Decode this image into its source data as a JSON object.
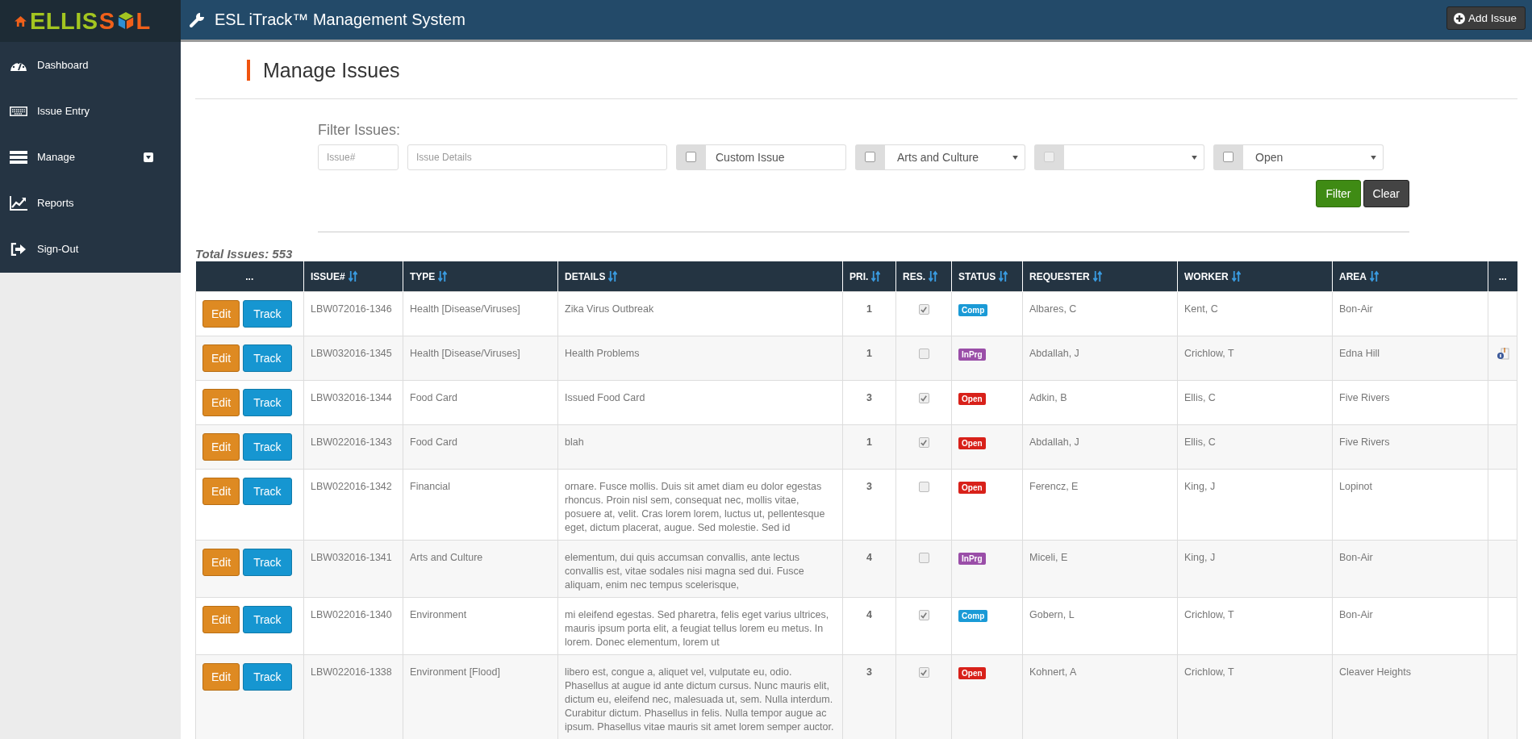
{
  "logo": {
    "parts": [
      {
        "kind": "text",
        "text": "ELLIS",
        "color": "#a3c520"
      },
      {
        "kind": "text",
        "text": "S",
        "color": "#f0601a"
      },
      {
        "kind": "cube"
      },
      {
        "kind": "text",
        "text": "L",
        "color": "#f0601a"
      }
    ]
  },
  "header": {
    "title": "ESL iTrack™ Management System",
    "add_button": "Add Issue"
  },
  "sidebar": {
    "items": [
      {
        "label": "Dashboard",
        "dropdown": false
      },
      {
        "label": "Issue Entry",
        "dropdown": false
      },
      {
        "label": "Manage",
        "dropdown": true
      },
      {
        "label": "Reports",
        "dropdown": false
      },
      {
        "label": "Sign-Out",
        "dropdown": false
      }
    ]
  },
  "page_title": "Manage Issues",
  "filter": {
    "label": "Filter Issues:",
    "issue_number": {
      "placeholder": "Issue#"
    },
    "details": {
      "placeholder": "Issue Details"
    },
    "groups": [
      {
        "kind": "text",
        "checked": false,
        "disabled": false,
        "value": "Custom Issue"
      },
      {
        "kind": "select",
        "checked": false,
        "disabled": false,
        "value": "Arts and Culture"
      },
      {
        "kind": "select",
        "checked": false,
        "disabled": true
      },
      {
        "kind": "select",
        "checked": false,
        "disabled": false,
        "value": "Open"
      }
    ],
    "filter_button": "Filter",
    "clear_button": "Clear"
  },
  "total": "Total Issues: 553",
  "table": {
    "columns": [
      {
        "label": "...",
        "sortable": false
      },
      {
        "label": "ISSUE#",
        "sortable": true
      },
      {
        "label": "TYPE",
        "sortable": true
      },
      {
        "label": "DETAILS",
        "sortable": true
      },
      {
        "label": "PRI.",
        "sortable": true
      },
      {
        "label": "RES.",
        "sortable": true
      },
      {
        "label": "STATUS",
        "sortable": true
      },
      {
        "label": "REQUESTER",
        "sortable": true
      },
      {
        "label": "WORKER",
        "sortable": true
      },
      {
        "label": "AREA",
        "sortable": true
      },
      {
        "label": "...",
        "sortable": false
      }
    ],
    "rows": [
      {
        "edit": "Edit",
        "track": "Track",
        "issue": "LBW072016-1346",
        "type": "Health [Disease/Viruses]",
        "details": "Zika Virus Outbreak",
        "priority": "1",
        "resolved": true,
        "status": "Comp",
        "color": "#1a9ad6",
        "requester": "Albares, C",
        "worker": "Kent, C",
        "area": "Bon-Air",
        "attachment": false
      },
      {
        "edit": "Edit",
        "track": "Track",
        "issue": "LBW032016-1345",
        "type": "Health [Disease/Viruses]",
        "details": "Health Problems",
        "priority": "1",
        "resolved": false,
        "status": "InPrg",
        "color": "#9a4ea8",
        "requester": "Abdallah, J",
        "worker": "Crichlow, T",
        "area": "Edna Hill",
        "attachment": true
      },
      {
        "edit": "Edit",
        "track": "Track",
        "issue": "LBW032016-1344",
        "type": "Food Card",
        "details": "Issued Food Card",
        "priority": "3",
        "resolved": true,
        "status": "Open",
        "color": "#d8211a",
        "requester": "Adkin, B",
        "worker": "Ellis, C",
        "area": "Five Rivers",
        "attachment": false
      },
      {
        "edit": "Edit",
        "track": "Track",
        "issue": "LBW022016-1343",
        "type": "Food Card",
        "details": "blah",
        "priority": "1",
        "resolved": true,
        "status": "Open",
        "color": "#d8211a",
        "requester": "Abdallah, J",
        "worker": "Ellis, C",
        "area": "Five Rivers",
        "attachment": false
      },
      {
        "edit": "Edit",
        "track": "Track",
        "issue": "LBW022016-1342",
        "type": "Financial",
        "details": "ornare. Fusce mollis. Duis sit amet diam eu dolor egestas rhoncus. Proin nisl sem, consequat nec, mollis vitae, posuere at, velit. Cras lorem lorem, luctus ut, pellentesque eget, dictum placerat, augue. Sed molestie. Sed id",
        "priority": "3",
        "resolved": false,
        "status": "Open",
        "color": "#d8211a",
        "requester": "Ferencz, E",
        "worker": "King, J",
        "area": "Lopinot",
        "attachment": false
      },
      {
        "edit": "Edit",
        "track": "Track",
        "issue": "LBW032016-1341",
        "type": "Arts and Culture",
        "details": "elementum, dui quis accumsan convallis, ante lectus convallis est, vitae sodales nisi magna sed dui. Fusce aliquam, enim nec tempus scelerisque,",
        "priority": "4",
        "resolved": false,
        "status": "InPrg",
        "color": "#9a4ea8",
        "requester": "Miceli, E",
        "worker": "King, J",
        "area": "Bon-Air",
        "attachment": false
      },
      {
        "edit": "Edit",
        "track": "Track",
        "issue": "LBW022016-1340",
        "type": "Environment",
        "details": "mi eleifend egestas. Sed pharetra, felis eget varius ultrices, mauris ipsum porta elit, a feugiat tellus lorem eu metus. In lorem. Donec elementum, lorem ut",
        "priority": "4",
        "resolved": true,
        "status": "Comp",
        "color": "#1a9ad6",
        "requester": "Gobern, L",
        "worker": "Crichlow, T",
        "area": "Bon-Air",
        "attachment": false
      },
      {
        "edit": "Edit",
        "track": "Track",
        "issue": "LBW022016-1338",
        "type": "Environment [Flood]",
        "details": "libero est, congue a, aliquet vel, vulputate eu, odio. Phasellus at augue id ante dictum cursus. Nunc mauris elit, dictum eu, eleifend nec, malesuada ut, sem. Nulla interdum. Curabitur dictum. Phasellus in felis. Nulla tempor augue ac ipsum. Phasellus vitae mauris sit amet lorem semper auctor.",
        "priority": "3",
        "resolved": true,
        "status": "Open",
        "color": "#d8211a",
        "requester": "Kohnert, A",
        "worker": "Crichlow, T",
        "area": "Cleaver Heights",
        "attachment": false
      }
    ]
  }
}
